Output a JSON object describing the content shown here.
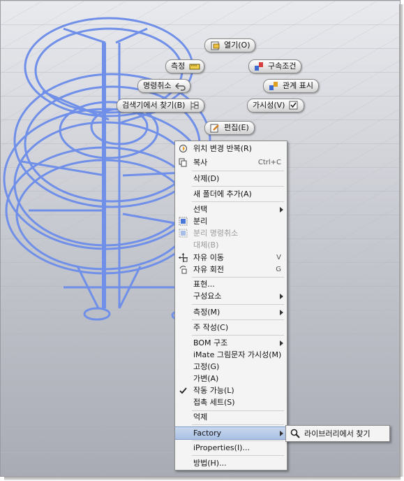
{
  "marking_menu": {
    "open": "열기(O)",
    "measure": "측정",
    "constraint": "구속조건",
    "cancel": "명령취소",
    "show_relations": "관계 표시",
    "find_in_browser": "검색기에서 찾기(B)",
    "visibility": "가시성(V)",
    "edit": "편집(E)"
  },
  "context_menu": {
    "items": [
      {
        "label": "위치 변경 반복(R)",
        "icon": "repeat-reposition-icon"
      },
      {
        "label": "복사",
        "shortcut": "Ctrl+C",
        "icon": "copy-icon"
      },
      {
        "label": "삭제(D)"
      },
      {
        "label": "새 폴더에 추가(A)"
      },
      {
        "label": "선택",
        "submenu": true
      },
      {
        "label": "분리",
        "icon": "isolate-icon"
      },
      {
        "label": "분리 명령취소",
        "disabled": true,
        "icon": "undo-isolate-icon"
      },
      {
        "label": "대체(B)",
        "disabled": true
      },
      {
        "label": "자유 이동",
        "shortcut": "V",
        "icon": "free-move-icon"
      },
      {
        "label": "자유 회전",
        "shortcut": "G",
        "icon": "free-rotate-icon"
      },
      {
        "label": "표현..."
      },
      {
        "label": "구성요소",
        "submenu": true
      },
      {
        "label": "측정(M)",
        "submenu": true
      },
      {
        "label": "주 작성(C)"
      },
      {
        "label": "BOM 구조",
        "submenu": true
      },
      {
        "label": "iMate 그림문자 가시성(M)"
      },
      {
        "label": "고정(G)"
      },
      {
        "label": "가변(A)"
      },
      {
        "label": "작동 가능(L)",
        "checked": true
      },
      {
        "label": "접촉 세트(S)"
      },
      {
        "label": "억제"
      },
      {
        "label": "Factory",
        "submenu": true,
        "highlighted": true
      },
      {
        "label": "iProperties(I)..."
      },
      {
        "label": "방법(H)..."
      }
    ]
  },
  "submenu": {
    "find_in_library": "라이브러리에서 찾기"
  },
  "colors": {
    "selection_blue": "#6f8fe8",
    "highlight": "#a9c1e4"
  }
}
